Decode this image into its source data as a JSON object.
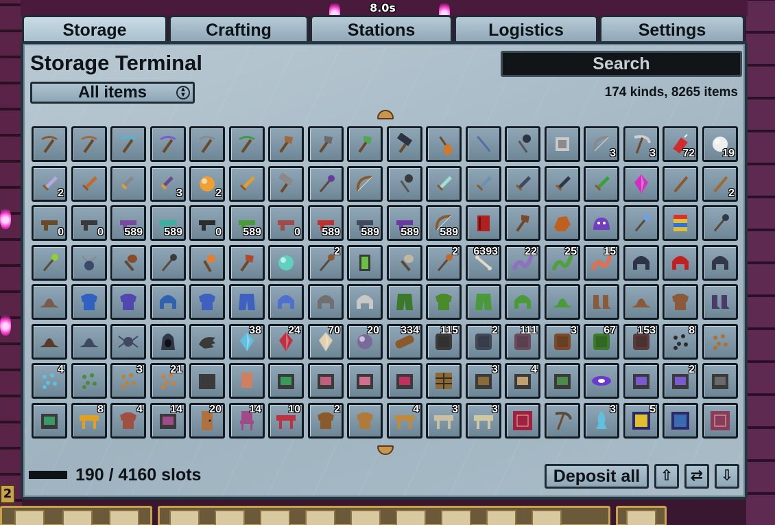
{
  "hud": {
    "timer": "8.0s",
    "hotbar_number": "2"
  },
  "tabs": [
    {
      "label": "Storage",
      "active": true
    },
    {
      "label": "Crafting",
      "active": false
    },
    {
      "label": "Stations",
      "active": false
    },
    {
      "label": "Logistics",
      "active": false
    },
    {
      "label": "Settings",
      "active": false
    }
  ],
  "terminal": {
    "title": "Storage Terminal",
    "search_placeholder": "Search",
    "filter_label": "All items",
    "summary": "174 kinds, 8265 items",
    "slots_text": "190 / 4160 slots",
    "deposit_label": "Deposit all"
  },
  "controls": {
    "sort_asc_icon": "sort-ascending-icon",
    "cycle_icon": "cycle-icon",
    "sort_desc_icon": "sort-descending-icon"
  },
  "items": [
    [
      "pickaxe",
      "#8b5a2b",
      ""
    ],
    [
      "pickaxe",
      "#9c6b3a",
      ""
    ],
    [
      "pickaxe",
      "#4fb6d6",
      ""
    ],
    [
      "pickaxe",
      "#7b5ad6",
      ""
    ],
    [
      "pickaxe",
      "#8a8a8a",
      ""
    ],
    [
      "pickaxe",
      "#3f9a3f",
      ""
    ],
    [
      "axe",
      "#a0693a",
      ""
    ],
    [
      "axe",
      "#6b6b6b",
      ""
    ],
    [
      "axe",
      "#4fa84f",
      ""
    ],
    [
      "hammer",
      "#2c3440",
      ""
    ],
    [
      "shovel",
      "#d0782c",
      ""
    ],
    [
      "spear",
      "#5070a0",
      ""
    ],
    [
      "mace",
      "#2c3440",
      ""
    ],
    [
      "block",
      "#c8c8c8",
      ""
    ],
    [
      "bow",
      "#8a8a8a",
      "3"
    ],
    [
      "scythe",
      "#cfcfcf",
      "3"
    ],
    [
      "dynamite",
      "#d02c2c",
      "72"
    ],
    [
      "orb",
      "#eeeeee",
      "19"
    ],
    [
      "sword",
      "#b8a8e0",
      "2"
    ],
    [
      "sword",
      "#c06a30",
      ""
    ],
    [
      "dagger",
      "#888888",
      ""
    ],
    [
      "dagger",
      "#6a4a8a",
      "3"
    ],
    [
      "orb",
      "#f0a030",
      "2"
    ],
    [
      "sword",
      "#e0a030",
      ""
    ],
    [
      "hammer",
      "#8a8a8a",
      ""
    ],
    [
      "staff",
      "#6a3a9a",
      ""
    ],
    [
      "bow",
      "#8b5a2b",
      ""
    ],
    [
      "mace",
      "#3a3a3a",
      ""
    ],
    [
      "sword",
      "#a0e0d0",
      ""
    ],
    [
      "sword",
      "#7090b0",
      ""
    ],
    [
      "sword",
      "#404860",
      ""
    ],
    [
      "sword",
      "#303848",
      ""
    ],
    [
      "sword",
      "#3aa03a",
      ""
    ],
    [
      "crystal",
      "#d030c0",
      ""
    ],
    [
      "stick",
      "#8b5a2b",
      ""
    ],
    [
      "stick",
      "#a06a30",
      "2"
    ],
    [
      "gun",
      "#6b4a2a",
      "0"
    ],
    [
      "gun",
      "#3a3a3a",
      "0"
    ],
    [
      "gun",
      "#7a4aa0",
      "589"
    ],
    [
      "gun",
      "#3ab0a0",
      "589"
    ],
    [
      "gun",
      "#2c2c2c",
      "0"
    ],
    [
      "gun",
      "#4a9a3a",
      "589"
    ],
    [
      "gun",
      "#a04a4a",
      "0"
    ],
    [
      "gun",
      "#c03030",
      "589"
    ],
    [
      "gun",
      "#404a60",
      "589"
    ],
    [
      "gun",
      "#6a3aa0",
      "589"
    ],
    [
      "bow",
      "#8b5a2b",
      "589"
    ],
    [
      "book",
      "#b02020",
      ""
    ],
    [
      "axe",
      "#7a4a2a",
      ""
    ],
    [
      "rock",
      "#c06020",
      ""
    ],
    [
      "slime",
      "#7040c0",
      ""
    ],
    [
      "staff",
      "#70a0e0",
      ""
    ],
    [
      "rainbow",
      "#e0c030",
      ""
    ],
    [
      "staff",
      "#303848",
      ""
    ],
    [
      "staff",
      "#90d030",
      ""
    ],
    [
      "amulet",
      "#3a4a6a",
      ""
    ],
    [
      "club",
      "#8b4a2a",
      ""
    ],
    [
      "staff",
      "#3a3a3a",
      ""
    ],
    [
      "torch",
      "#e08030",
      ""
    ],
    [
      "axe",
      "#b04a2a",
      ""
    ],
    [
      "orb",
      "#60d0c0",
      ""
    ],
    [
      "staff",
      "#8b5a3a",
      "2"
    ],
    [
      "card",
      "#6ac040",
      ""
    ],
    [
      "club",
      "#c0b8a0",
      ""
    ],
    [
      "staff",
      "#c06a30",
      "2"
    ],
    [
      "bone",
      "#e0d8c8",
      "6393"
    ],
    [
      "worm",
      "#9070c0",
      "22"
    ],
    [
      "worm",
      "#50a040",
      "25"
    ],
    [
      "worm",
      "#e07050",
      "15"
    ],
    [
      "helm",
      "#2c3448",
      ""
    ],
    [
      "helm",
      "#c02020",
      ""
    ],
    [
      "helm",
      "#303848",
      ""
    ],
    [
      "hat",
      "#7a5a4a",
      ""
    ],
    [
      "chest",
      "#3060c0",
      ""
    ],
    [
      "chest",
      "#5048b0",
      ""
    ],
    [
      "helm",
      "#3060b0",
      ""
    ],
    [
      "chest",
      "#4060c0",
      ""
    ],
    [
      "pants",
      "#4060c0",
      ""
    ],
    [
      "helm",
      "#5070d0",
      ""
    ],
    [
      "helm",
      "#707070",
      ""
    ],
    [
      "helm",
      "#c8c8c8",
      ""
    ],
    [
      "pants",
      "#3a7a2a",
      ""
    ],
    [
      "chest",
      "#4a8a2a",
      ""
    ],
    [
      "pants",
      "#4a9a3a",
      ""
    ],
    [
      "helm",
      "#4a9a3a",
      ""
    ],
    [
      "hat",
      "#4a9a3a",
      ""
    ],
    [
      "boots",
      "#8b5a3a",
      ""
    ],
    [
      "hat",
      "#8b5a3a",
      ""
    ],
    [
      "chest",
      "#8b5a3a",
      ""
    ],
    [
      "boots",
      "#4a3a6a",
      ""
    ],
    [
      "hat",
      "#5a3a2a",
      ""
    ],
    [
      "hat",
      "#404860",
      ""
    ],
    [
      "spider",
      "#404860",
      ""
    ],
    [
      "hood",
      "#303848",
      ""
    ],
    [
      "claw",
      "#3a3a3a",
      ""
    ],
    [
      "crystal",
      "#60c0e0",
      "38"
    ],
    [
      "crystal",
      "#c03040",
      "24"
    ],
    [
      "crystal",
      "#e0d0b0",
      "70"
    ],
    [
      "orb",
      "#7a6a9a",
      "20"
    ],
    [
      "log",
      "#8b5a2b",
      "334"
    ],
    [
      "ore",
      "#3a3a3a",
      "115"
    ],
    [
      "ore",
      "#404858",
      "2"
    ],
    [
      "ore",
      "#6a4a5a",
      "111"
    ],
    [
      "ore",
      "#7a4a2a",
      "3"
    ],
    [
      "ore",
      "#3a7a2a",
      "67"
    ],
    [
      "ore",
      "#5a3a3a",
      "153"
    ],
    [
      "seeds",
      "#2c2c2c",
      "8"
    ],
    [
      "seeds",
      "#b07030",
      ""
    ],
    [
      "seeds",
      "#60c0e0",
      "4"
    ],
    [
      "seeds",
      "#4a8a3a",
      ""
    ],
    [
      "seeds",
      "#c08030",
      "3"
    ],
    [
      "seeds",
      "#d08030",
      "21"
    ],
    [
      "station",
      "#3a3a3a",
      ""
    ],
    [
      "banner",
      "#d08060",
      ""
    ],
    [
      "station",
      "#3a9a5a",
      ""
    ],
    [
      "station",
      "#c06080",
      ""
    ],
    [
      "station",
      "#d07090",
      ""
    ],
    [
      "station",
      "#c03060",
      ""
    ],
    [
      "shelf",
      "#8b6a3a",
      ""
    ],
    [
      "station",
      "#8b6a3a",
      "3"
    ],
    [
      "station",
      "#c0a070",
      "4"
    ],
    [
      "station",
      "#4a8a4a",
      ""
    ],
    [
      "portal",
      "#6a3ad0",
      ""
    ],
    [
      "station",
      "#7a5ad0",
      ""
    ],
    [
      "station",
      "#7a5ad0",
      "2"
    ],
    [
      "station",
      "#6a6a6a",
      ""
    ],
    [
      "station",
      "#3a9a6a",
      ""
    ],
    [
      "table",
      "#e0a020",
      "8"
    ],
    [
      "chest",
      "#a05040",
      "4"
    ],
    [
      "station",
      "#a04a8a",
      "14"
    ],
    [
      "door",
      "#b07040",
      "20"
    ],
    [
      "chair",
      "#a04a8a",
      "14"
    ],
    [
      "table",
      "#c03040",
      "10"
    ],
    [
      "chest",
      "#8b5a2b",
      "2"
    ],
    [
      "chest",
      "#b07a3a",
      ""
    ],
    [
      "table",
      "#c08a3a",
      "4"
    ],
    [
      "table",
      "#c8c0a0",
      "3"
    ],
    [
      "table",
      "#d0c8a0",
      "3"
    ],
    [
      "rug",
      "#a02040",
      ""
    ],
    [
      "scythe",
      "#5a4a3a",
      ""
    ],
    [
      "statue",
      "#60c0e0",
      "3"
    ],
    [
      "painting",
      "#e0c030",
      "5"
    ],
    [
      "painting",
      "#3a6ab0",
      ""
    ],
    [
      "rug",
      "#8a3a5a",
      ""
    ]
  ]
}
